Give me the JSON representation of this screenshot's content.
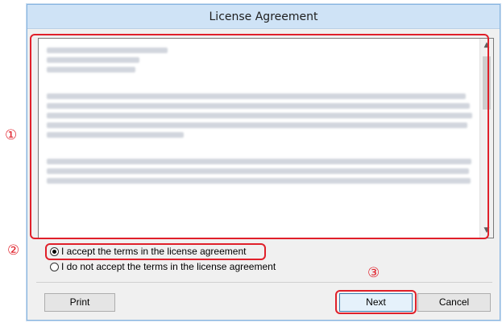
{
  "window": {
    "title": "License Agreement"
  },
  "license": {
    "text_blurred": true
  },
  "options": {
    "accept_label": "I accept the terms in the license agreement",
    "decline_label": "I do not accept the terms in the license agreement",
    "selected": "accept"
  },
  "buttons": {
    "print": "Print",
    "next": "Next",
    "cancel": "Cancel"
  },
  "annotations": {
    "marker1": "①",
    "marker2": "②",
    "marker3": "③",
    "highlight_color": "#e0202a"
  },
  "scrollbar": {
    "up": "▲",
    "down": "▼"
  }
}
